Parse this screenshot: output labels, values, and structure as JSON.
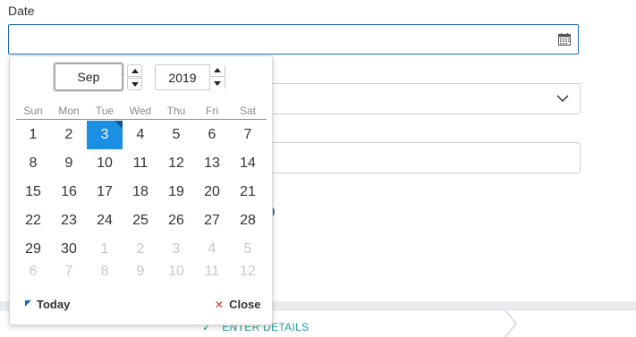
{
  "form": {
    "date_label": "Date",
    "date_value": "",
    "step_label": "ENTER DETAILS"
  },
  "calendar": {
    "month": "Sep",
    "year": "2019",
    "weekdays": [
      "Sun",
      "Mon",
      "Tue",
      "Wed",
      "Thu",
      "Fri",
      "Sat"
    ],
    "weeks": [
      [
        "1",
        "2",
        "3",
        "4",
        "5",
        "6",
        "7"
      ],
      [
        "8",
        "9",
        "10",
        "11",
        "12",
        "13",
        "14"
      ],
      [
        "15",
        "16",
        "17",
        "18",
        "19",
        "20",
        "21"
      ],
      [
        "22",
        "23",
        "24",
        "25",
        "26",
        "27",
        "28"
      ],
      [
        "29",
        "30",
        "1",
        "2",
        "3",
        "4",
        "5"
      ],
      [
        "6",
        "7",
        "8",
        "9",
        "10",
        "11",
        "12"
      ]
    ],
    "selected_day": "3",
    "today_label": "Today",
    "close_label": "Close"
  },
  "icons": {
    "calendar": "calendar-icon",
    "chevron": "chevron-down-icon",
    "check": "check-icon",
    "close": "close-icon"
  },
  "colors": {
    "accent": "#1a8fe3",
    "input_border": "#1f6cb2",
    "step_text": "#1e9a8c",
    "close_x": "#d9372b"
  }
}
